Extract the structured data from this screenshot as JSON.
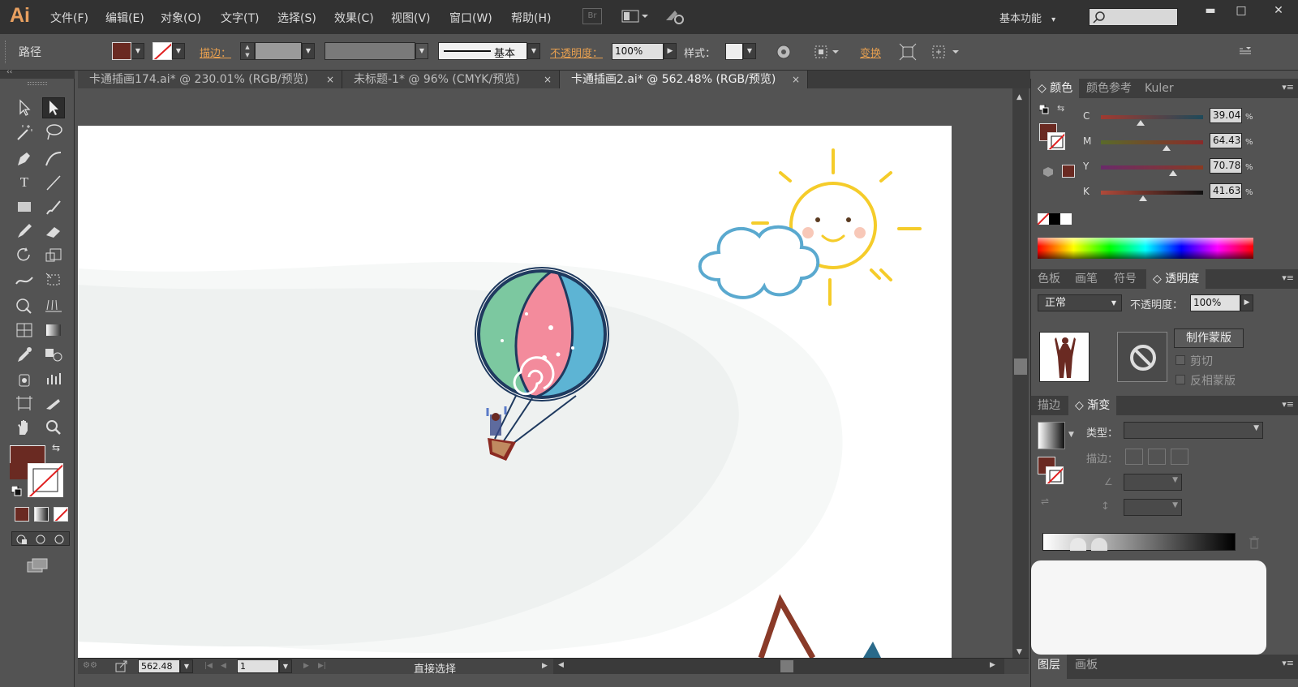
{
  "app": {
    "logo": "Ai"
  },
  "menus": [
    "文件(F)",
    "编辑(E)",
    "对象(O)",
    "文字(T)",
    "选择(S)",
    "效果(C)",
    "视图(V)",
    "窗口(W)",
    "帮助(H)"
  ],
  "menu_icons": {
    "bridge": "Br"
  },
  "workspace": {
    "label": "基本功能",
    "arrow": "▾"
  },
  "window_controls": {
    "minimize": "▬",
    "maximize": "□",
    "close": "✕"
  },
  "control_bar": {
    "object_type": "路径",
    "stroke_label": "描边：",
    "brush_label": "基本",
    "opacity_label": "不透明度：",
    "opacity_value": "100%",
    "style_label": "样式：",
    "transform_label": "变换"
  },
  "tabs": [
    {
      "label": "卡通插画174.ai* @ 230.01% (RGB/预览)",
      "close": "×"
    },
    {
      "label": "未标题-1* @ 96% (CMYK/预览)",
      "close": "×"
    },
    {
      "label": "卡通插画2.ai* @ 562.48% (RGB/预览)",
      "close": "×"
    }
  ],
  "colors": {
    "fill": "#6a2a22",
    "menubar": "#323232",
    "panel": "#535353",
    "sun": "#f5cc2a",
    "cloud": "#5aa9cf",
    "balloon_green": "#7cc8a0",
    "balloon_pink": "#f38b9c",
    "balloon_blue": "#5db4d4",
    "balloon_outline": "#1f3a5f",
    "mountain": "#8a3a28"
  },
  "color_panel": {
    "tabs": [
      "颜色",
      "颜色参考",
      "Kuler"
    ],
    "channels": [
      {
        "label": "C",
        "value": "39.04",
        "level": 39.04
      },
      {
        "label": "M",
        "value": "64.43",
        "level": 64.43
      },
      {
        "label": "Y",
        "value": "70.78",
        "level": 70.78
      },
      {
        "label": "K",
        "value": "41.63",
        "level": 41.63
      }
    ],
    "percent": "%"
  },
  "transparency_panel": {
    "tabs": [
      "色板",
      "画笔",
      "符号",
      "透明度"
    ],
    "blend_mode": "正常",
    "opacity_label": "不透明度：",
    "opacity_value": "100%",
    "make_mask": "制作蒙版",
    "clip": "剪切",
    "invert_mask": "反相蒙版"
  },
  "gradient_panel": {
    "tabs": [
      "描边",
      "渐变"
    ],
    "type_label": "类型：",
    "stroke_label": "描边："
  },
  "bottom_panel": {
    "tabs": [
      "图层",
      "画板"
    ]
  },
  "status": {
    "zoom": "562.48",
    "page": "1",
    "tool": "直接选择"
  }
}
